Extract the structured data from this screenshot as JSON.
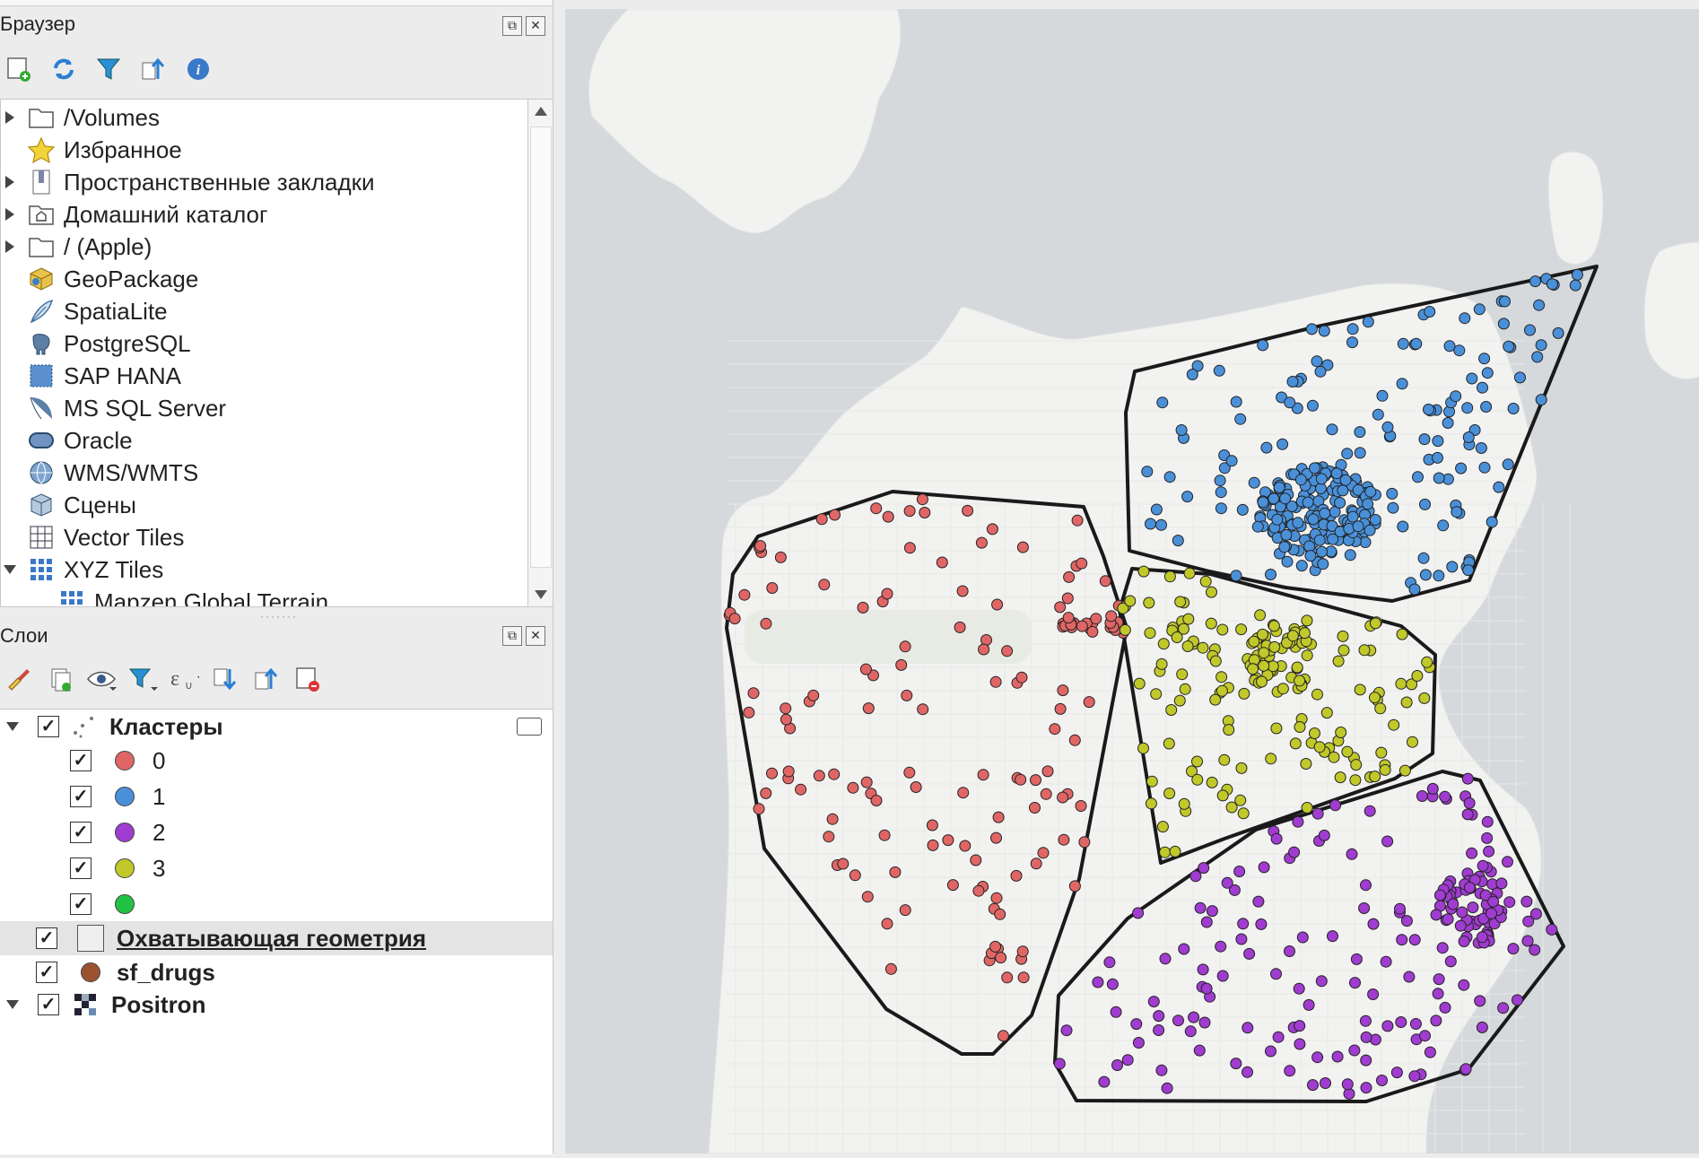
{
  "browser": {
    "title": "Браузер",
    "items": [
      {
        "label": "/Volumes",
        "icon": "folder-icon",
        "expandable": true
      },
      {
        "label": "Избранное",
        "icon": "star-icon",
        "expandable": false
      },
      {
        "label": "Пространственные закладки",
        "icon": "bookmark-icon",
        "expandable": true
      },
      {
        "label": "Домашний каталог",
        "icon": "home-folder-icon",
        "expandable": true
      },
      {
        "label": "/ (Apple)",
        "icon": "folder-icon",
        "expandable": true
      },
      {
        "label": "GeoPackage",
        "icon": "geopackage-icon",
        "expandable": false
      },
      {
        "label": "SpatiaLite",
        "icon": "feather-icon",
        "expandable": false
      },
      {
        "label": "PostgreSQL",
        "icon": "elephant-icon",
        "expandable": false
      },
      {
        "label": "SAP HANA",
        "icon": "sap-hana-icon",
        "expandable": false
      },
      {
        "label": "MS SQL Server",
        "icon": "mssql-icon",
        "expandable": false
      },
      {
        "label": "Oracle",
        "icon": "oracle-icon",
        "expandable": false
      },
      {
        "label": "WMS/WMTS",
        "icon": "globe-icon",
        "expandable": false
      },
      {
        "label": "Сцены",
        "icon": "cube-icon",
        "expandable": false
      },
      {
        "label": "Vector Tiles",
        "icon": "grid-icon",
        "expandable": false
      },
      {
        "label": "XYZ Tiles",
        "icon": "tiles-icon",
        "expandable": true,
        "expanded": true
      },
      {
        "label": "Mapzen Global Terrain",
        "icon": "tiles-icon",
        "expandable": false
      }
    ]
  },
  "layers": {
    "title": "Слои",
    "items": [
      {
        "label": "Кластеры",
        "bold": true,
        "checked": true
      },
      {
        "label": "0",
        "color": "#e06666",
        "checked": true
      },
      {
        "label": "1",
        "color": "#4a90d9",
        "checked": true
      },
      {
        "label": "2",
        "color": "#a03cd0",
        "checked": true
      },
      {
        "label": "3",
        "color": "#c0c82a",
        "checked": true
      },
      {
        "label": "",
        "color": "#22c244",
        "checked": true
      },
      {
        "label": "Охватывающая геометрия",
        "bold": true,
        "checked": true,
        "selected": true
      },
      {
        "label": "sf_drugs",
        "bold": true,
        "checked": true,
        "color": "#9a5230"
      },
      {
        "label": "Positron",
        "bold": true,
        "checked": true
      }
    ]
  },
  "colors": {
    "cluster0": "#e06666",
    "cluster1": "#4a90d9",
    "cluster2": "#a03cd0",
    "cluster3": "#c0c82a",
    "hull": "#1a1a1a",
    "map_water": "#d5d9dc",
    "map_land": "#f2f2f1"
  }
}
